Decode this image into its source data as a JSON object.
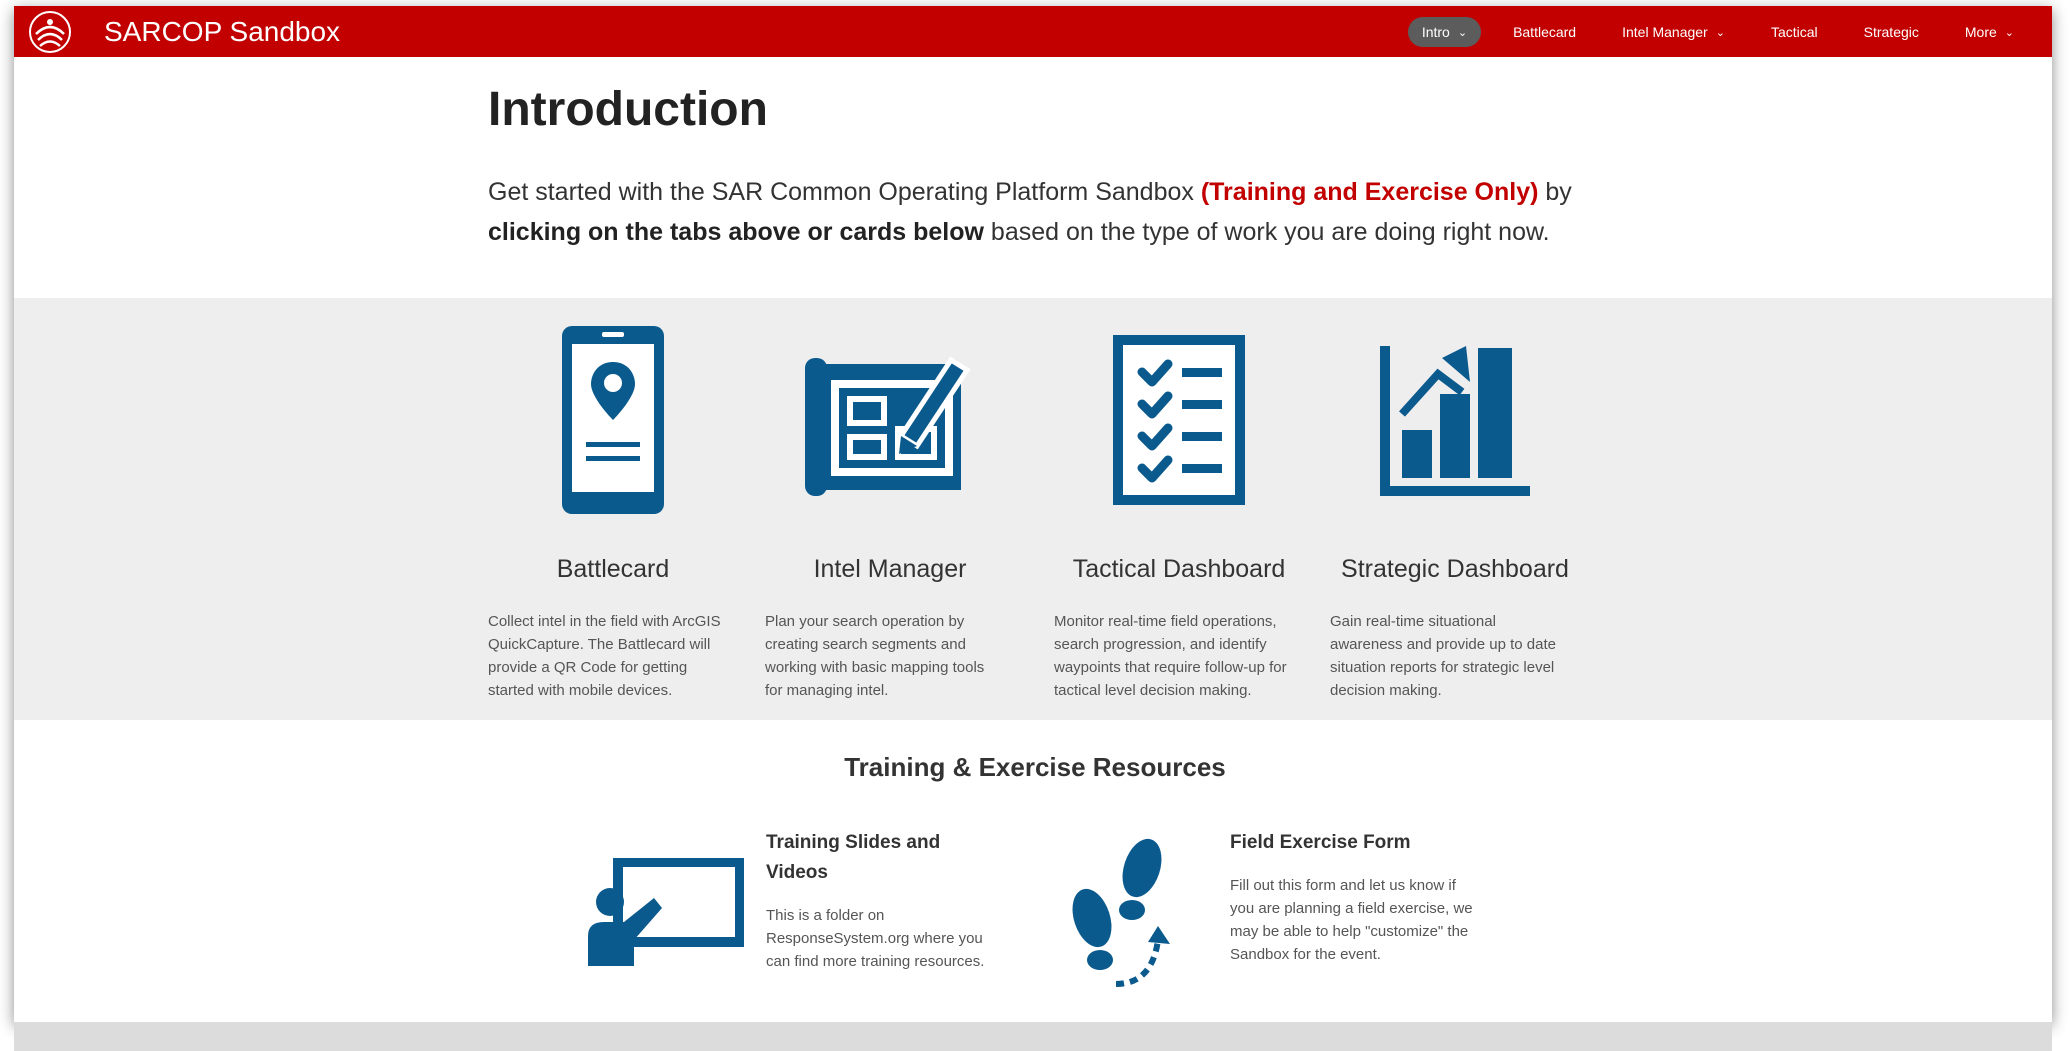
{
  "colors": {
    "brand_red": "#c20000",
    "icon_blue": "#0b5a8e",
    "band_gray": "#eeeeee"
  },
  "header": {
    "title": "SARCOP Sandbox",
    "nav": [
      {
        "label": "Intro",
        "has_dropdown": true,
        "active": true
      },
      {
        "label": "Battlecard",
        "has_dropdown": false
      },
      {
        "label": "Intel Manager",
        "has_dropdown": true
      },
      {
        "label": "Tactical",
        "has_dropdown": false
      },
      {
        "label": "Strategic",
        "has_dropdown": false
      },
      {
        "label": "More",
        "has_dropdown": true
      }
    ],
    "chevron": "⌄"
  },
  "intro": {
    "heading": "Introduction",
    "p1": "Get started with the SAR Common Operating Platform Sandbox ",
    "p1_red": "(Training and Exercise Only)",
    "p2": " by ",
    "p2_bold": "clicking on the tabs above or cards below",
    "p3": " based on the type of work you are doing right now."
  },
  "cards": [
    {
      "title": "Battlecard",
      "icon": "mobile-location-icon",
      "desc": "Collect intel in the field with ArcGIS QuickCapture. The Battlecard will provide a QR Code for getting started with mobile devices."
    },
    {
      "title": "Intel Manager",
      "icon": "blueprint-pencil-icon",
      "desc": "Plan your search operation by creating search segments and working with basic mapping tools for managing intel."
    },
    {
      "title": "Tactical Dashboard",
      "icon": "checklist-icon",
      "desc": "Monitor real-time field operations, search progression, and identify waypoints that require follow-up for tactical level decision making."
    },
    {
      "title": "Strategic Dashboard",
      "icon": "bar-chart-icon",
      "desc": "Gain real-time situational awareness and provide up to date situation reports for strategic level decision making."
    }
  ],
  "resources": {
    "title": "Training & Exercise Resources",
    "items": [
      {
        "title": "Training Slides and Videos",
        "icon": "presentation-icon",
        "desc": "This is a folder on ResponseSystem.org where you can find more training resources."
      },
      {
        "title": "Field Exercise Form",
        "icon": "footsteps-icon",
        "desc": "Fill out this form and let us know if you are planning a field exercise, we may be able to help \"customize\" the Sandbox for the event."
      }
    ]
  }
}
